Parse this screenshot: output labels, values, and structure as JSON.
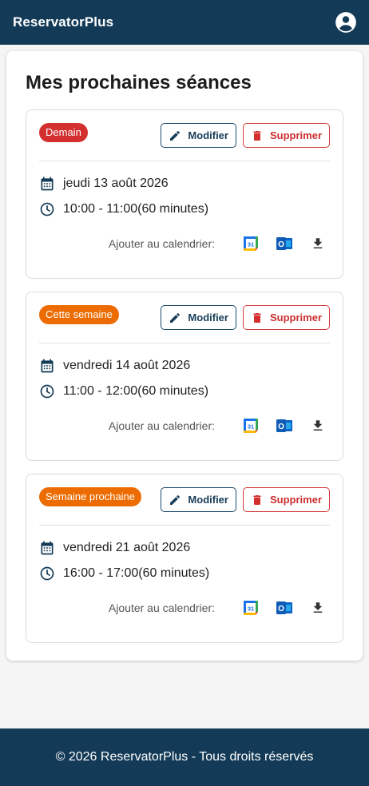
{
  "header": {
    "brand": "ReservatorPlus"
  },
  "main": {
    "title": "Mes prochaines séances"
  },
  "sessions": [
    {
      "badge": "Demain",
      "badge_color": "#d32f2f",
      "edit_label": "Modifier",
      "delete_label": "Supprimer",
      "date": "jeudi 13 août 2026",
      "time": "10:00 - 11:00(60 minutes)",
      "calendar_label": "Ajouter au calendrier:"
    },
    {
      "badge": "Cette semaine",
      "badge_color": "#ed6c02",
      "edit_label": "Modifier",
      "delete_label": "Supprimer",
      "date": "vendredi 14 août 2026",
      "time": "11:00 - 12:00(60 minutes)",
      "calendar_label": "Ajouter au calendrier:"
    },
    {
      "badge": "Semaine prochaine",
      "badge_color": "#ed6c02",
      "edit_label": "Modifier",
      "delete_label": "Supprimer",
      "date": "vendredi 21 août 2026",
      "time": "16:00 - 17:00(60 minutes)",
      "calendar_label": "Ajouter au calendrier:"
    }
  ],
  "icons": {
    "account": "account-circle-icon",
    "edit": "pencil-icon",
    "delete": "trash-icon",
    "date": "calendar-icon",
    "time": "clock-icon",
    "google": "google-calendar-icon",
    "google_day": "31",
    "outlook": "outlook-icon",
    "outlook_letter": "O",
    "download": "download-icon"
  },
  "colors": {
    "primary": "#133a56",
    "danger": "#d32f2f",
    "warning": "#ed6c02"
  },
  "footer": {
    "text": "© 2026 ReservatorPlus - Tous droits réservés"
  }
}
